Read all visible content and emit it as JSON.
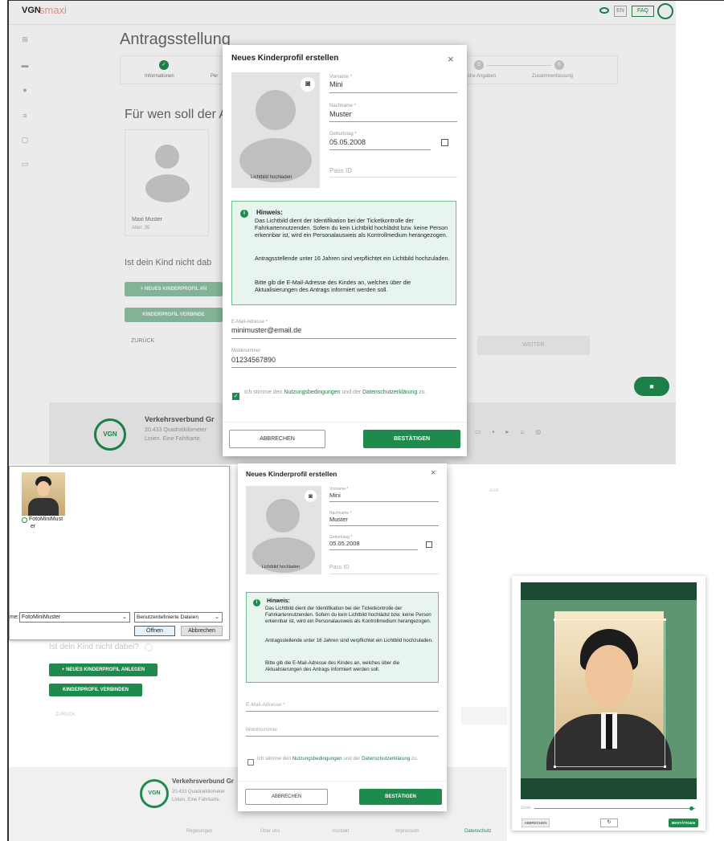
{
  "app": {
    "brand_vgn": "VGN",
    "brand_smaxi": "smaxi",
    "lang": "EN",
    "faq": "FAQ"
  },
  "page": {
    "title": "Antragsstellung",
    "question": "Für wen soll der A",
    "steps": [
      "Informationen",
      "Per",
      "che Angaben",
      "Zusammenfassung"
    ],
    "step_numbers": [
      "5",
      "6"
    ],
    "card_name": "Maxi Muster",
    "card_age": "Alter: 35",
    "not_here": "Ist dein Kind nicht dab",
    "not_here_full": "Ist dein Kind nicht dabei?",
    "new_profile_btn": "+ NEUES KINDERPROFIL AN",
    "new_profile_btn_full": "+ NEUES KINDERPROFIL ANLEGEN",
    "connect_btn": "KINDERPROFIL VERBINDE",
    "connect_btn_full": "KINDERPROFIL VERBINDEN",
    "back": "ZURÜCK",
    "next": "WEITER"
  },
  "footer": {
    "title": "Verkehrsverbund Gr",
    "title2": "Verkehrsverbund Gr",
    "line1": "20.433 Quadratkilometer",
    "line2": "Linien. Eine Fahrkarte.",
    "logo": "VGN",
    "links": [
      "Regelungen",
      "Über uns",
      "Kontakt",
      "Impressum",
      "Datenschutz"
    ]
  },
  "modal": {
    "title": "Neues Kinderprofil erstellen",
    "close": "×",
    "photo_label": "Lichtbild hochladen",
    "vorname_label": "Vorname *",
    "vorname": "Mini",
    "nachname_label": "Nachname *",
    "nachname": "Muster",
    "geburtstag_label": "Geburtstag *",
    "geburtstag": "05.05.2008",
    "pass_placeholder": "Pass ID",
    "hint_title": "Hinweis:",
    "hint_p1": "Das Lichtbild dient der Identifikation bei der Ticketkontrolle der Fahrkartennutzenden. Sofern du kein Lichtbild hochlädst bzw. keine Person erkennbar ist, wird ein Personalausweis als Kontrollmedium herangezogen.",
    "hint_p2": "Antragsstellende unter 16 Jahren sind verpflichtet ein Lichtbild hochzuladen.",
    "hint_p3": "Bitte gib die E-Mail-Adresse des Kindes an, welches über die Aktualisierungen des Antrags informiert werden soll.",
    "email_label": "E-Mail-Adresse *",
    "email": "minimuster@email.de",
    "mobil_label": "Mobilnummer",
    "mobil": "01234567890",
    "consent_pre": "Ich stimme den ",
    "consent_link1": "Nutzungsbedingungen",
    "consent_mid": " und der ",
    "consent_link2": "Datenschutzerklärung",
    "consent_post": " zu.",
    "cancel": "ABBRECHEN",
    "confirm": "BESTÄTIGEN"
  },
  "modal2": {
    "email_placeholder": "E-Mail-Adresse *",
    "mobil_placeholder": "Mobilnummer"
  },
  "file_dialog": {
    "file_name": "FotoMiniMust",
    "file_name2": "er",
    "name_label": "me:",
    "name_value": "FotoMiniMuster",
    "type_value": "Benutzerdefinierte Dateien",
    "open": "Öffnen",
    "cancel": "Abbrechen"
  },
  "cropper": {
    "zoom_label": "Zoom",
    "cancel": "ABBRECHEN",
    "rotate": "↻",
    "confirm": "BESTÄTIGEN",
    "zoom_level": 0.98
  },
  "misc": {
    "zoll": "Zust"
  },
  "colors": {
    "green": "#1e8a4c",
    "hint_bg": "#e8f5ee",
    "crop_bg": "#5f9672"
  }
}
